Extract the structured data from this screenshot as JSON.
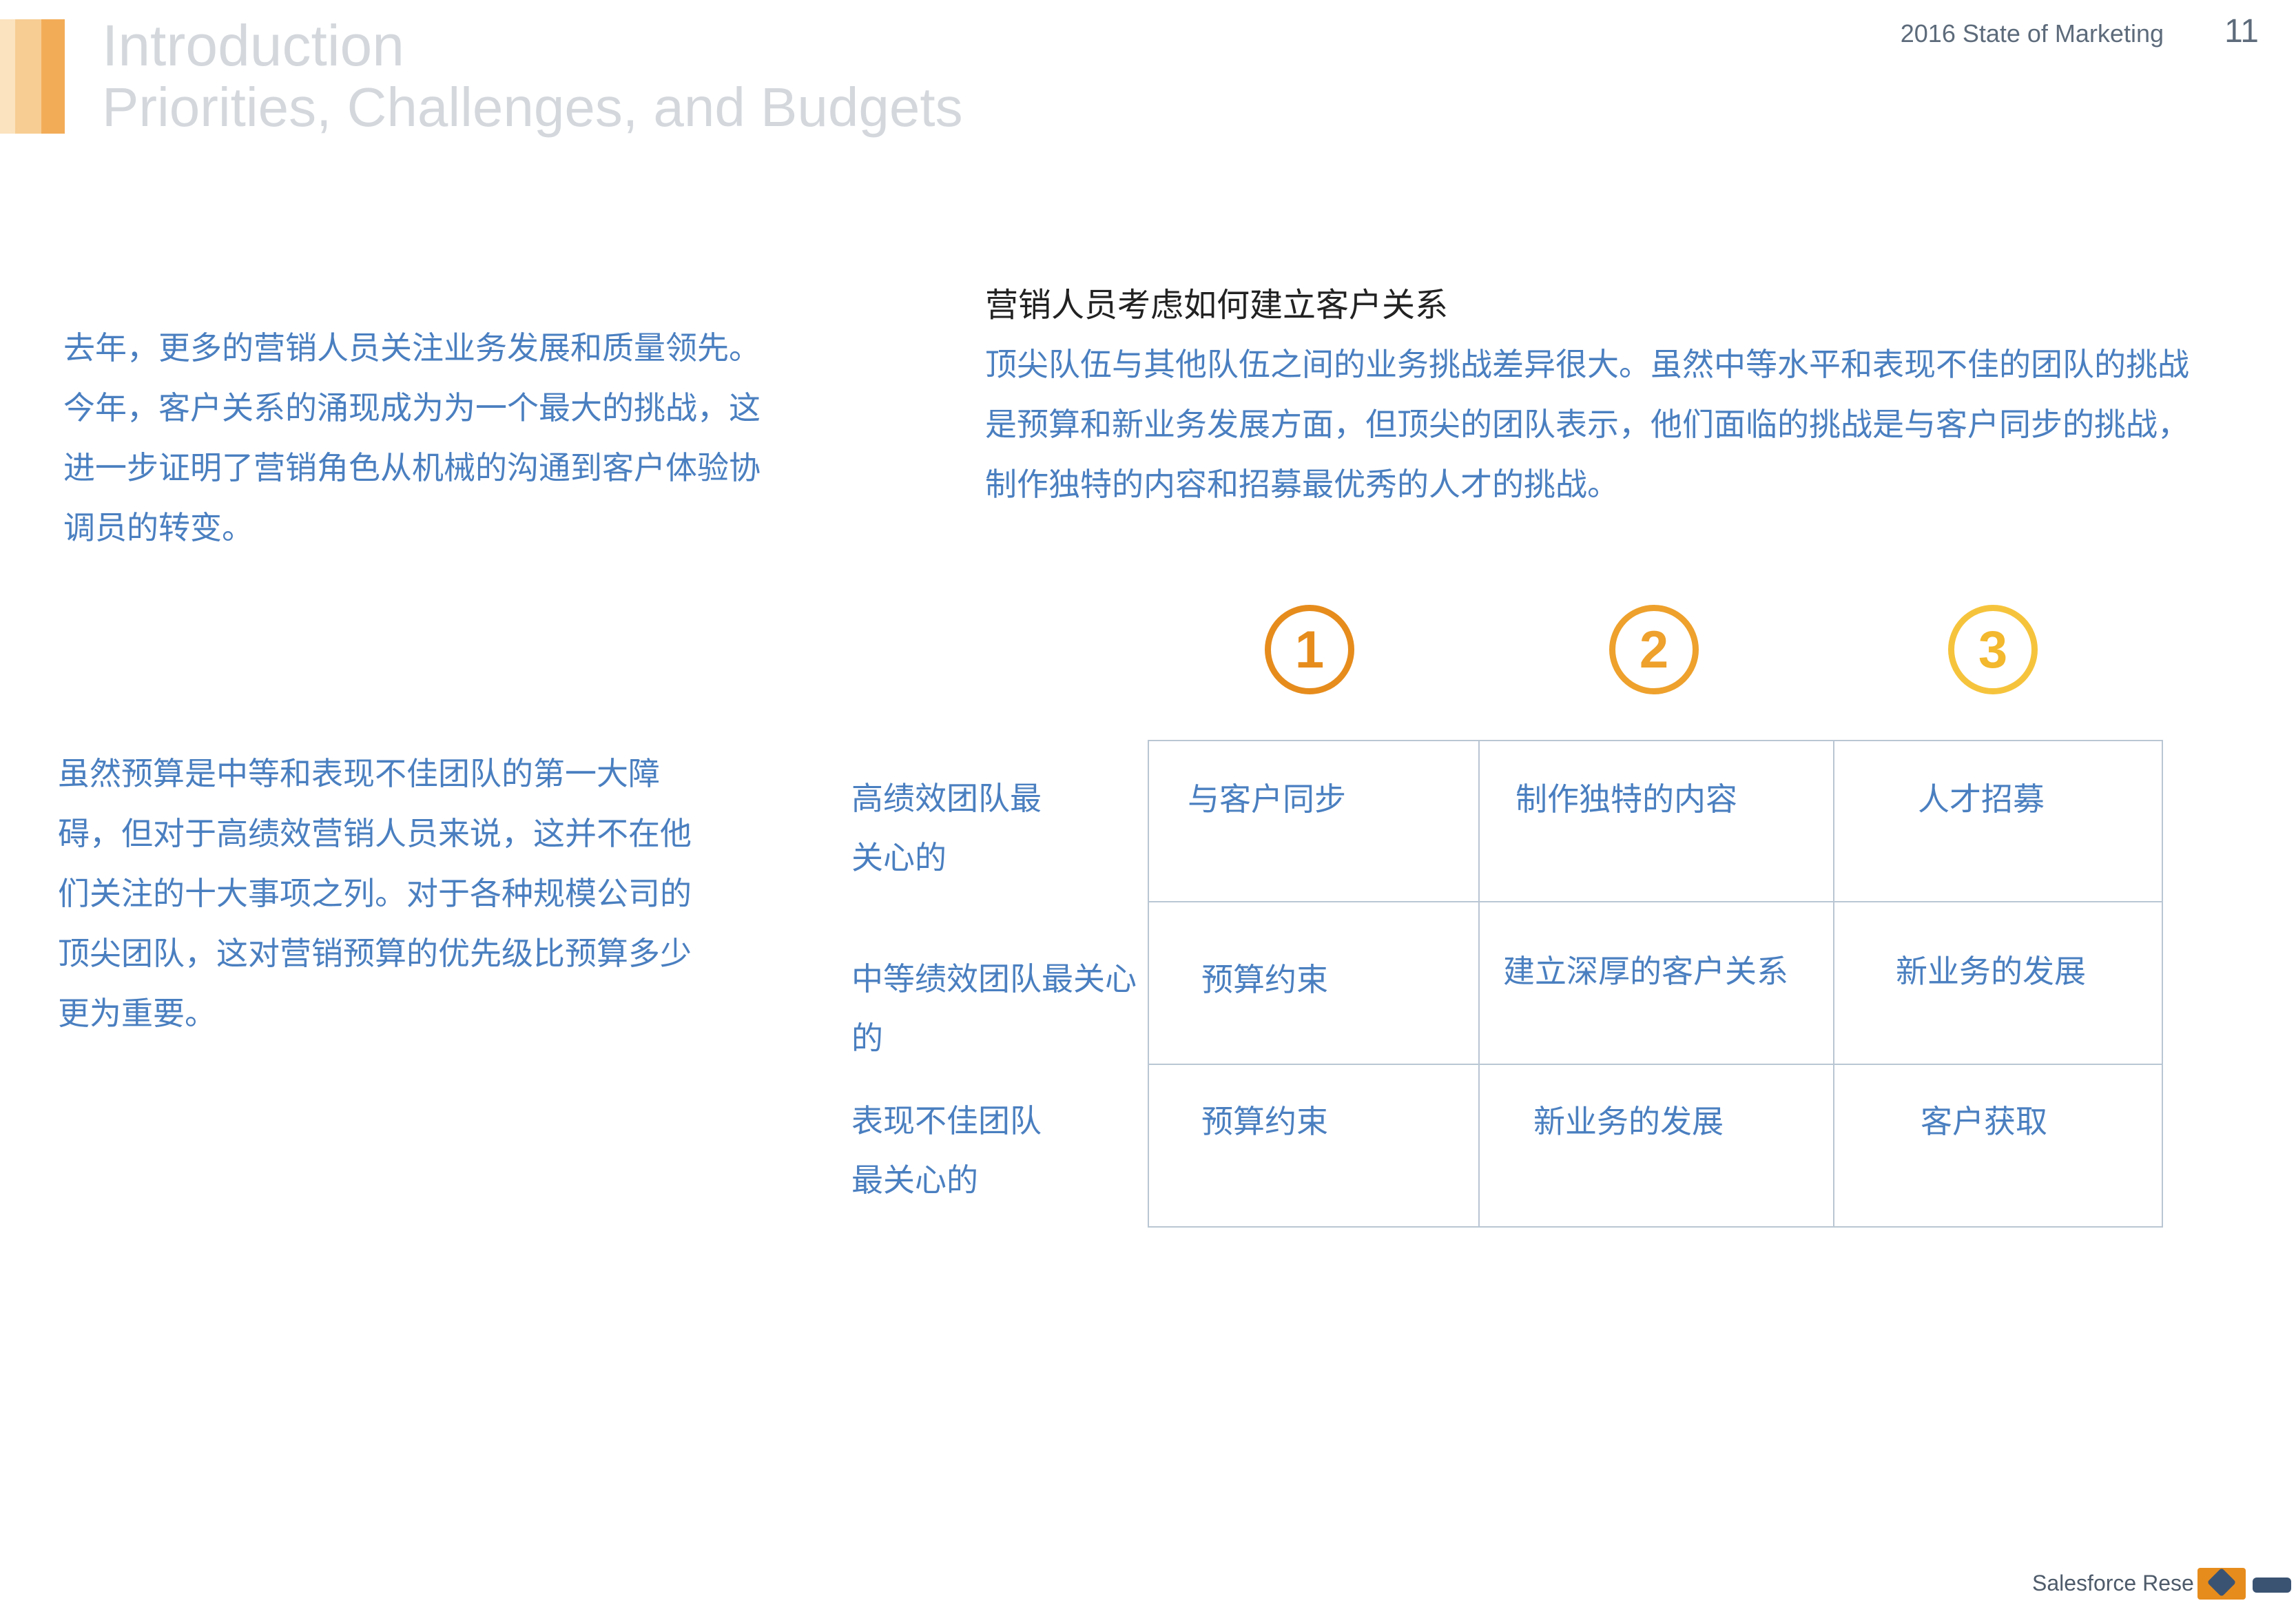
{
  "header": {
    "title": "Introduction",
    "subtitle": "Priorities, Challenges, and Budgets",
    "report_name": "2016 State of Marketing",
    "page_number": "11",
    "accent_colors": [
      "#fbe3bf",
      "#f7cd93",
      "#f2ac58"
    ]
  },
  "left": {
    "paragraph1": "去年，更多的营销人员关注业务发展和质量领先。今年，客户关系的涌现成为为一个最大的挑战，这进一步证明了营销角色从机械的沟通到客户体验协调员的转变。",
    "paragraph2": "虽然预算是中等和表现不佳团队的第一大障碍，但对于高绩效营销人员来说，这并不在他们关注的十大事项之列。对于各种规模公司的顶尖团队，这对营销预算的优先级比预算多少更为重要。"
  },
  "right": {
    "section_title": "营销人员考虑如何建立客户关系",
    "paragraph": "顶尖队伍与其他队伍之间的业务挑战差异很大。虽然中等水平和表现不佳的团队的挑战是预算和新业务发展方面，但顶尖的团队表示，他们面临的挑战是与客户同步的挑战，制作独特的内容和招募最优秀的人才的挑战。"
  },
  "ranks": [
    "1",
    "2",
    "3"
  ],
  "rank_colors": [
    "#e68c1d",
    "#eea12c",
    "#f6c43c"
  ],
  "table": {
    "rows": [
      {
        "label": "高绩效团队最关心的",
        "cells": [
          "与客户同步",
          "制作独特的内容",
          "人才招募"
        ]
      },
      {
        "label": "中等绩效团队最关心的",
        "cells": [
          "预算约束",
          "建立深厚的客户关系",
          "新业务的发展"
        ]
      },
      {
        "label": "表现不佳团队最关心的",
        "cells": [
          "预算约束",
          "新业务的发展",
          "客户获取"
        ]
      }
    ]
  },
  "footer": {
    "text": "Salesforce Rese",
    "logo_icon": "salesforce-research-logo-icon"
  },
  "colors": {
    "body_text": "#4a7fc0",
    "heading_text": "#222222",
    "header_text": "#d4d8dd",
    "table_border": "#b9c6d3"
  }
}
